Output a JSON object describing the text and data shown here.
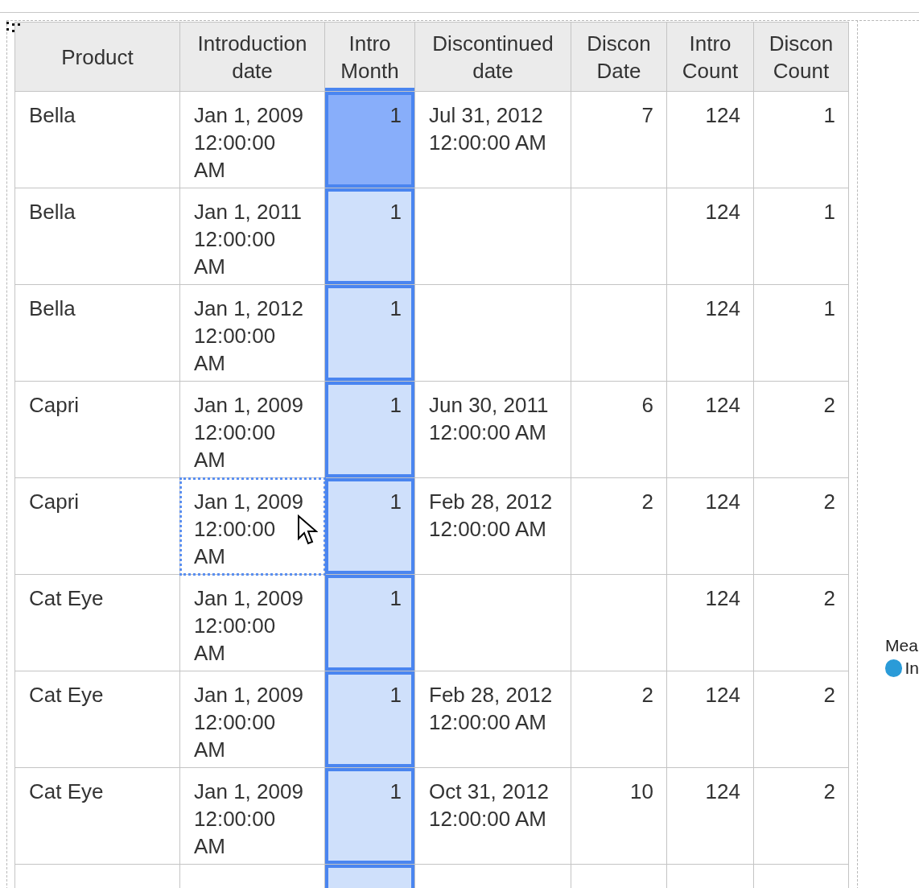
{
  "table": {
    "columns": [
      {
        "label": "Product",
        "kind": "text",
        "selected": false
      },
      {
        "label": "Introduction date",
        "kind": "text",
        "selected": false
      },
      {
        "label": "Intro Month",
        "kind": "number",
        "selected": true
      },
      {
        "label": "Discontinued date",
        "kind": "text",
        "selected": false
      },
      {
        "label": "Discon Date",
        "kind": "number",
        "selected": false
      },
      {
        "label": "Intro Count",
        "kind": "number",
        "selected": false
      },
      {
        "label": "Discon Count",
        "kind": "number",
        "selected": false
      }
    ],
    "rows": [
      {
        "current": true,
        "focused": false,
        "cells": [
          "Bella",
          "Jan 1, 2009 12:00:00 AM",
          "1",
          "Jul 31, 2012 12:00:00 AM",
          "7",
          "124",
          "1"
        ]
      },
      {
        "current": false,
        "focused": false,
        "cells": [
          "Bella",
          "Jan 1, 2011 12:00:00 AM",
          "1",
          null,
          null,
          "124",
          "1"
        ]
      },
      {
        "current": false,
        "focused": false,
        "cells": [
          "Bella",
          "Jan 1, 2012 12:00:00 AM",
          "1",
          null,
          null,
          "124",
          "1"
        ]
      },
      {
        "current": false,
        "focused": false,
        "cells": [
          "Capri",
          "Jan 1, 2009 12:00:00 AM",
          "1",
          "Jun 30, 2011 12:00:00 AM",
          "6",
          "124",
          "2"
        ]
      },
      {
        "current": false,
        "focused": true,
        "cells": [
          "Capri",
          "Jan 1, 2009 12:00:00 AM",
          "1",
          "Feb 28, 2012 12:00:00 AM",
          "2",
          "124",
          "2"
        ]
      },
      {
        "current": false,
        "focused": false,
        "cells": [
          "Cat Eye",
          "Jan 1, 2009 12:00:00 AM",
          "1",
          null,
          null,
          "124",
          "2"
        ]
      },
      {
        "current": false,
        "focused": false,
        "cells": [
          "Cat Eye",
          "Jan 1, 2009 12:00:00 AM",
          "1",
          "Feb 28, 2012 12:00:00 AM",
          "2",
          "124",
          "2"
        ]
      },
      {
        "current": false,
        "focused": false,
        "cells": [
          "Cat Eye",
          "Jan 1, 2009 12:00:00 AM",
          "1",
          "Oct 31, 2012 12:00:00 AM",
          "10",
          "124",
          "2"
        ]
      }
    ]
  },
  "legend": {
    "title": "Mea",
    "items": [
      {
        "label": "In",
        "color": "#2a9bd8"
      }
    ]
  }
}
